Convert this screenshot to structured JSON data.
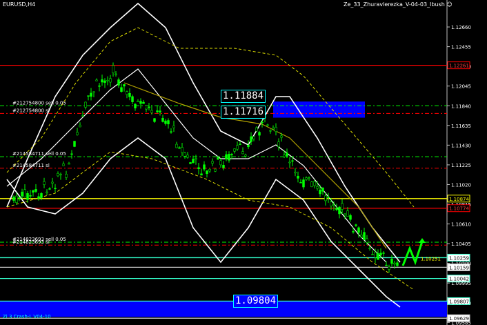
{
  "header": {
    "symbol": "EURUSD,H4",
    "expert": "Ze_33_Zhuravlerezka_V-04-03_Ibush",
    "expert_icon": "smiley-icon"
  },
  "price_scale": [
    "1.12660",
    "1.12455",
    "1.12250",
    "1.12045",
    "1.11840",
    "1.11635",
    "1.11430",
    "1.11225",
    "1.11020",
    "1.10815",
    "1.10610",
    "1.10405",
    "1.10200",
    "1.09995",
    "1.09790",
    "1.09585"
  ],
  "price_range": [
    1.0958,
    1.1284
  ],
  "levels": [
    {
      "price": 1.12261,
      "label": "1.12261",
      "color": "#ff0000",
      "style": "solid",
      "tag_bg": "#000000",
      "tag_fg": "#ff4040"
    },
    {
      "price": 1.10874,
      "label": "1.10874",
      "color": "#ffff00",
      "style": "solid",
      "tag_bg": "#000000",
      "tag_fg": "#ffff00"
    },
    {
      "price": 1.10774,
      "label": "1.10774",
      "color": "#ff0000",
      "style": "solid",
      "tag_bg": "#000000",
      "tag_fg": "#ff4040"
    },
    {
      "price": 1.10259,
      "label": "1.10259",
      "color": "#33ffcc",
      "style": "solid",
      "tag_bg": "#ffffff",
      "tag_fg": "#000000"
    },
    {
      "price": 1.10159,
      "label": "1.10159",
      "color": "#c0c0c0",
      "style": "solid",
      "tag_bg": "#ffffff",
      "tag_fg": "#000000"
    },
    {
      "price": 1.10042,
      "label": "1.10042",
      "color": "#33ffcc",
      "style": "solid",
      "tag_bg": "#ffffff",
      "tag_fg": "#000000"
    },
    {
      "price": 1.09807,
      "label": "1.09807",
      "color": "#33ffcc",
      "style": "solid",
      "tag_bg": "#ffffff",
      "tag_fg": "#000000"
    },
    {
      "price": 1.09629,
      "label": "1.09629",
      "color": "#c0c0c0",
      "style": "solid",
      "tag_bg": "#ffffff",
      "tag_fg": "#000000"
    }
  ],
  "order_lines": [
    {
      "price": 1.1184,
      "text": "#212754800 sell 0.05",
      "color": "#00ff00"
    },
    {
      "price": 1.1176,
      "text": "#212754800 sl",
      "color": "#ff0000"
    },
    {
      "price": 1.1131,
      "text": "#214584711 sell 0.05",
      "color": "#00ff00"
    },
    {
      "price": 1.1119,
      "text": "#214584711 sl",
      "color": "#ff0000"
    },
    {
      "price": 1.1042,
      "text": "#214823693 sell 0.05",
      "color": "#00ff00"
    },
    {
      "price": 1.1039,
      "text": "#214823693 sl",
      "color": "#ff0000"
    }
  ],
  "big_labels": [
    {
      "text": "1.11884"
    },
    {
      "text": "1.11716"
    },
    {
      "text": "1.09804"
    }
  ],
  "blue_zone_color": "#0000ff",
  "small_tag": "1.10251",
  "footer": "Zi 3 Crash-L V04-10",
  "colors": {
    "bull": "#00ff00",
    "bear": "#000000",
    "wick": "#00ff00",
    "band": "#ffffff",
    "ma": "#ffff00"
  }
}
